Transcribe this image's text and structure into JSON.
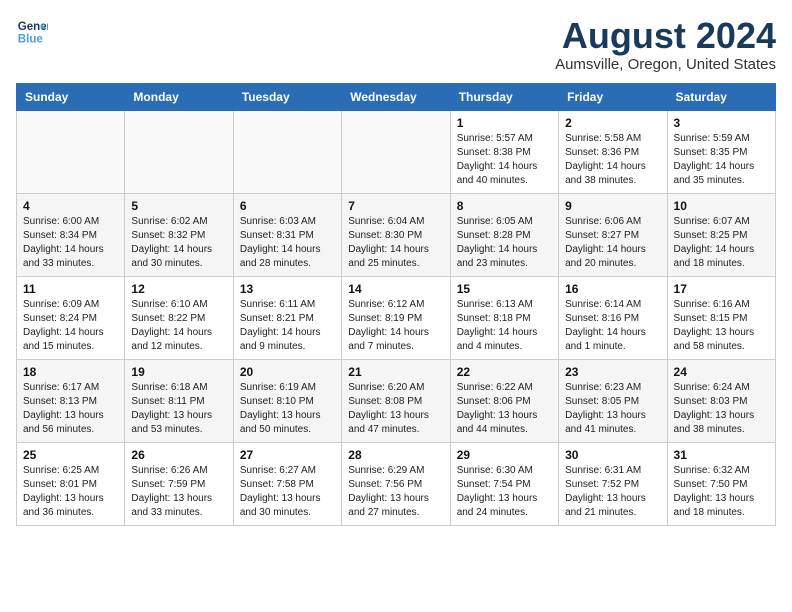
{
  "header": {
    "logo_line1": "General",
    "logo_line2": "Blue",
    "title": "August 2024",
    "subtitle": "Aumsville, Oregon, United States"
  },
  "weekdays": [
    "Sunday",
    "Monday",
    "Tuesday",
    "Wednesday",
    "Thursday",
    "Friday",
    "Saturday"
  ],
  "weeks": [
    [
      {
        "day": "",
        "sunrise": "",
        "sunset": "",
        "daylight": ""
      },
      {
        "day": "",
        "sunrise": "",
        "sunset": "",
        "daylight": ""
      },
      {
        "day": "",
        "sunrise": "",
        "sunset": "",
        "daylight": ""
      },
      {
        "day": "",
        "sunrise": "",
        "sunset": "",
        "daylight": ""
      },
      {
        "day": "1",
        "sunrise": "Sunrise: 5:57 AM",
        "sunset": "Sunset: 8:38 PM",
        "daylight": "Daylight: 14 hours and 40 minutes."
      },
      {
        "day": "2",
        "sunrise": "Sunrise: 5:58 AM",
        "sunset": "Sunset: 8:36 PM",
        "daylight": "Daylight: 14 hours and 38 minutes."
      },
      {
        "day": "3",
        "sunrise": "Sunrise: 5:59 AM",
        "sunset": "Sunset: 8:35 PM",
        "daylight": "Daylight: 14 hours and 35 minutes."
      }
    ],
    [
      {
        "day": "4",
        "sunrise": "Sunrise: 6:00 AM",
        "sunset": "Sunset: 8:34 PM",
        "daylight": "Daylight: 14 hours and 33 minutes."
      },
      {
        "day": "5",
        "sunrise": "Sunrise: 6:02 AM",
        "sunset": "Sunset: 8:32 PM",
        "daylight": "Daylight: 14 hours and 30 minutes."
      },
      {
        "day": "6",
        "sunrise": "Sunrise: 6:03 AM",
        "sunset": "Sunset: 8:31 PM",
        "daylight": "Daylight: 14 hours and 28 minutes."
      },
      {
        "day": "7",
        "sunrise": "Sunrise: 6:04 AM",
        "sunset": "Sunset: 8:30 PM",
        "daylight": "Daylight: 14 hours and 25 minutes."
      },
      {
        "day": "8",
        "sunrise": "Sunrise: 6:05 AM",
        "sunset": "Sunset: 8:28 PM",
        "daylight": "Daylight: 14 hours and 23 minutes."
      },
      {
        "day": "9",
        "sunrise": "Sunrise: 6:06 AM",
        "sunset": "Sunset: 8:27 PM",
        "daylight": "Daylight: 14 hours and 20 minutes."
      },
      {
        "day": "10",
        "sunrise": "Sunrise: 6:07 AM",
        "sunset": "Sunset: 8:25 PM",
        "daylight": "Daylight: 14 hours and 18 minutes."
      }
    ],
    [
      {
        "day": "11",
        "sunrise": "Sunrise: 6:09 AM",
        "sunset": "Sunset: 8:24 PM",
        "daylight": "Daylight: 14 hours and 15 minutes."
      },
      {
        "day": "12",
        "sunrise": "Sunrise: 6:10 AM",
        "sunset": "Sunset: 8:22 PM",
        "daylight": "Daylight: 14 hours and 12 minutes."
      },
      {
        "day": "13",
        "sunrise": "Sunrise: 6:11 AM",
        "sunset": "Sunset: 8:21 PM",
        "daylight": "Daylight: 14 hours and 9 minutes."
      },
      {
        "day": "14",
        "sunrise": "Sunrise: 6:12 AM",
        "sunset": "Sunset: 8:19 PM",
        "daylight": "Daylight: 14 hours and 7 minutes."
      },
      {
        "day": "15",
        "sunrise": "Sunrise: 6:13 AM",
        "sunset": "Sunset: 8:18 PM",
        "daylight": "Daylight: 14 hours and 4 minutes."
      },
      {
        "day": "16",
        "sunrise": "Sunrise: 6:14 AM",
        "sunset": "Sunset: 8:16 PM",
        "daylight": "Daylight: 14 hours and 1 minute."
      },
      {
        "day": "17",
        "sunrise": "Sunrise: 6:16 AM",
        "sunset": "Sunset: 8:15 PM",
        "daylight": "Daylight: 13 hours and 58 minutes."
      }
    ],
    [
      {
        "day": "18",
        "sunrise": "Sunrise: 6:17 AM",
        "sunset": "Sunset: 8:13 PM",
        "daylight": "Daylight: 13 hours and 56 minutes."
      },
      {
        "day": "19",
        "sunrise": "Sunrise: 6:18 AM",
        "sunset": "Sunset: 8:11 PM",
        "daylight": "Daylight: 13 hours and 53 minutes."
      },
      {
        "day": "20",
        "sunrise": "Sunrise: 6:19 AM",
        "sunset": "Sunset: 8:10 PM",
        "daylight": "Daylight: 13 hours and 50 minutes."
      },
      {
        "day": "21",
        "sunrise": "Sunrise: 6:20 AM",
        "sunset": "Sunset: 8:08 PM",
        "daylight": "Daylight: 13 hours and 47 minutes."
      },
      {
        "day": "22",
        "sunrise": "Sunrise: 6:22 AM",
        "sunset": "Sunset: 8:06 PM",
        "daylight": "Daylight: 13 hours and 44 minutes."
      },
      {
        "day": "23",
        "sunrise": "Sunrise: 6:23 AM",
        "sunset": "Sunset: 8:05 PM",
        "daylight": "Daylight: 13 hours and 41 minutes."
      },
      {
        "day": "24",
        "sunrise": "Sunrise: 6:24 AM",
        "sunset": "Sunset: 8:03 PM",
        "daylight": "Daylight: 13 hours and 38 minutes."
      }
    ],
    [
      {
        "day": "25",
        "sunrise": "Sunrise: 6:25 AM",
        "sunset": "Sunset: 8:01 PM",
        "daylight": "Daylight: 13 hours and 36 minutes."
      },
      {
        "day": "26",
        "sunrise": "Sunrise: 6:26 AM",
        "sunset": "Sunset: 7:59 PM",
        "daylight": "Daylight: 13 hours and 33 minutes."
      },
      {
        "day": "27",
        "sunrise": "Sunrise: 6:27 AM",
        "sunset": "Sunset: 7:58 PM",
        "daylight": "Daylight: 13 hours and 30 minutes."
      },
      {
        "day": "28",
        "sunrise": "Sunrise: 6:29 AM",
        "sunset": "Sunset: 7:56 PM",
        "daylight": "Daylight: 13 hours and 27 minutes."
      },
      {
        "day": "29",
        "sunrise": "Sunrise: 6:30 AM",
        "sunset": "Sunset: 7:54 PM",
        "daylight": "Daylight: 13 hours and 24 minutes."
      },
      {
        "day": "30",
        "sunrise": "Sunrise: 6:31 AM",
        "sunset": "Sunset: 7:52 PM",
        "daylight": "Daylight: 13 hours and 21 minutes."
      },
      {
        "day": "31",
        "sunrise": "Sunrise: 6:32 AM",
        "sunset": "Sunset: 7:50 PM",
        "daylight": "Daylight: 13 hours and 18 minutes."
      }
    ]
  ]
}
